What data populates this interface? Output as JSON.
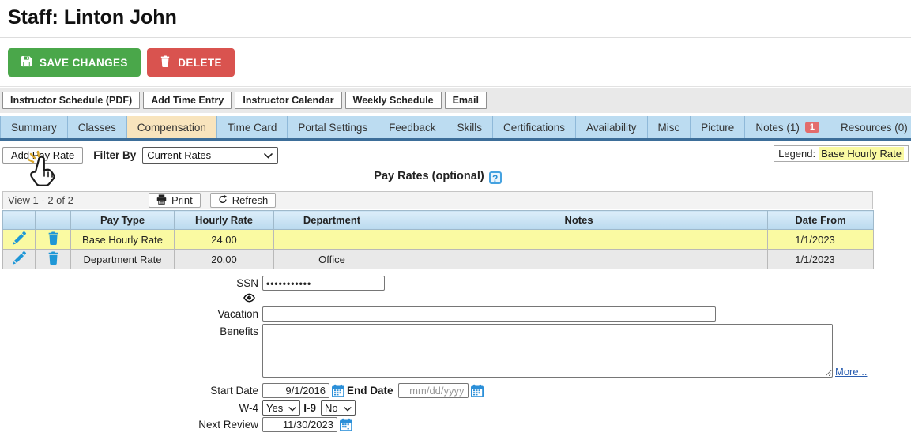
{
  "page": {
    "title": "Staff: Linton John"
  },
  "actions": {
    "save_label": "SAVE CHANGES",
    "delete_label": "DELETE"
  },
  "quick_links": [
    "Instructor Schedule (PDF)",
    "Add Time Entry",
    "Instructor Calendar",
    "Weekly Schedule",
    "Email"
  ],
  "tabs": [
    {
      "label": "Summary"
    },
    {
      "label": "Classes"
    },
    {
      "label": "Compensation",
      "active": true
    },
    {
      "label": "Time Card"
    },
    {
      "label": "Portal Settings"
    },
    {
      "label": "Feedback"
    },
    {
      "label": "Skills"
    },
    {
      "label": "Certifications"
    },
    {
      "label": "Availability"
    },
    {
      "label": "Misc"
    },
    {
      "label": "Picture"
    },
    {
      "label": "Notes (1)",
      "badge": "1"
    },
    {
      "label": "Resources (0)"
    }
  ],
  "controls": {
    "add_pay_rate_label": "Add Pay Rate",
    "filter_by_label": "Filter By",
    "filter_value": "Current Rates",
    "legend_label": "Legend:",
    "legend_value": "Base Hourly Rate"
  },
  "section": {
    "title": "Pay Rates (optional)",
    "help_glyph": "?"
  },
  "grid": {
    "view_text": "View 1 - 2 of 2",
    "print_label": "Print",
    "refresh_label": "Refresh",
    "columns": [
      "Pay Type",
      "Hourly Rate",
      "Department",
      "Notes",
      "Date From"
    ],
    "rows": [
      {
        "pay_type": "Base Hourly Rate",
        "hourly_rate": "24.00",
        "department": "",
        "notes": "",
        "date_from": "1/1/2023"
      },
      {
        "pay_type": "Department Rate",
        "hourly_rate": "20.00",
        "department": "Office",
        "notes": "",
        "date_from": "1/1/2023"
      }
    ]
  },
  "form": {
    "ssn_label": "SSN",
    "ssn_value": "•••••••••••",
    "vacation_label": "Vacation",
    "vacation_value": "",
    "benefits_label": "Benefits",
    "more_link": "More...",
    "start_date_label": "Start Date",
    "start_date_value": "9/1/2016",
    "end_date_label": "End Date",
    "end_date_placeholder": "mm/dd/yyyy",
    "w4_label": "W-4",
    "w4_value": "Yes",
    "i9_label": "I-9",
    "i9_value": "No",
    "next_review_label": "Next Review",
    "next_review_value": "11/30/2023"
  },
  "colors": {
    "save_green": "#4aa74a",
    "delete_red": "#d9534f",
    "highlight_yellow": "#fafaa2",
    "tab_blue": "#bcdcf1",
    "tab_active_cream": "#f8e4bd",
    "tab_underline": "#3d6e99",
    "icon_blue": "#1e97d6",
    "badge_red": "#e36c6c",
    "link_blue": "#2a5db0"
  }
}
